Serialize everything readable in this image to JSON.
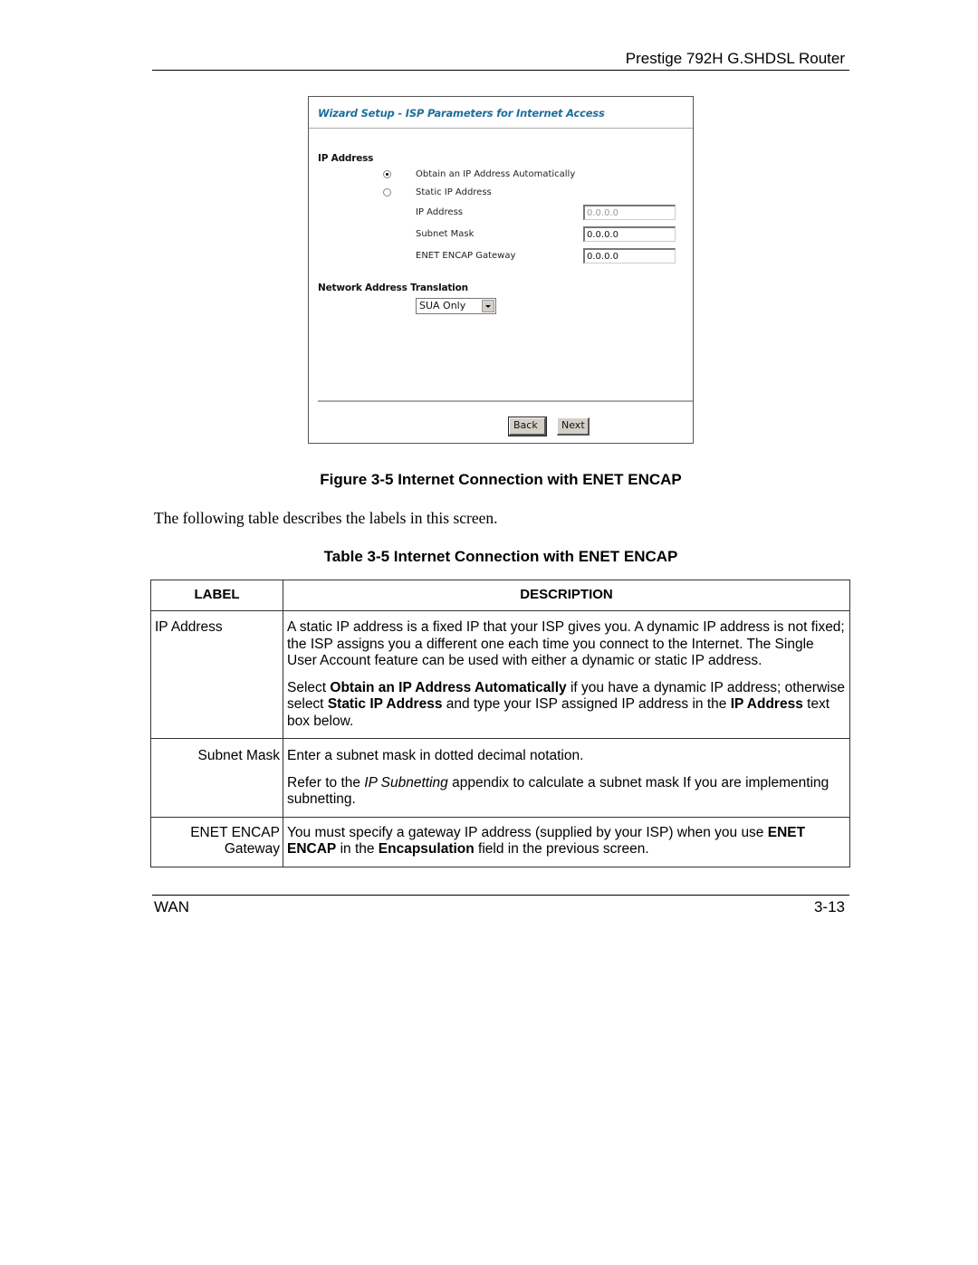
{
  "header": {
    "title": "Prestige 792H G.SHDSL Router"
  },
  "figure": {
    "wizard_title": "Wizard Setup - ISP Parameters for Internet Access",
    "ip_section_label": "IP Address",
    "radio_options": [
      {
        "label": "Obtain an IP Address Automatically",
        "checked": true
      },
      {
        "label": "Static IP Address",
        "checked": false
      }
    ],
    "fields": [
      {
        "label": "IP Address",
        "value": "0.0.0.0",
        "disabled": true
      },
      {
        "label": "Subnet Mask",
        "value": "0.0.0.0",
        "disabled": false
      },
      {
        "label": "ENET ENCAP Gateway",
        "value": "0.0.0.0",
        "disabled": false
      }
    ],
    "nat_section_label": "Network Address Translation",
    "nat_selected": "SUA Only",
    "back_label": "Back",
    "next_label": "Next",
    "caption": "Figure 3-5 Internet Connection with ENET ENCAP"
  },
  "intro_text": "The following table describes the labels in this screen.",
  "table": {
    "caption": "Table 3-5 Internet Connection with ENET ENCAP",
    "headers": [
      "LABEL",
      "DESCRIPTION"
    ],
    "rows": [
      {
        "label": "IP Address",
        "p1": "A static IP address is a fixed IP that your ISP gives you. A dynamic IP address is not fixed; the ISP assigns you a different one each time you connect to the Internet. The Single User Account feature can be used with either a dynamic or static IP address.",
        "p2_parts": [
          "Select ",
          "Obtain an IP Address Automatically",
          " if you have a dynamic IP address; otherwise select ",
          "Static IP Address",
          " and type your ISP assigned IP address in the ",
          "IP Address",
          " text box below."
        ]
      },
      {
        "label": "Subnet Mask",
        "p1": "Enter a subnet mask in dotted decimal notation.",
        "p2_parts": [
          "Refer to the ",
          "IP Subnetting",
          " appendix to calculate a subnet mask If you are implementing subnetting."
        ]
      },
      {
        "label_line1": "ENET ENCAP",
        "label_line2": "Gateway",
        "p1_parts": [
          "You must specify a gateway IP address (supplied by your ISP) when you use ",
          "ENET ENCAP",
          " in the ",
          "Encapsulation",
          " field in the previous screen."
        ]
      }
    ]
  },
  "footer": {
    "section": "WAN",
    "page": "3-13"
  }
}
